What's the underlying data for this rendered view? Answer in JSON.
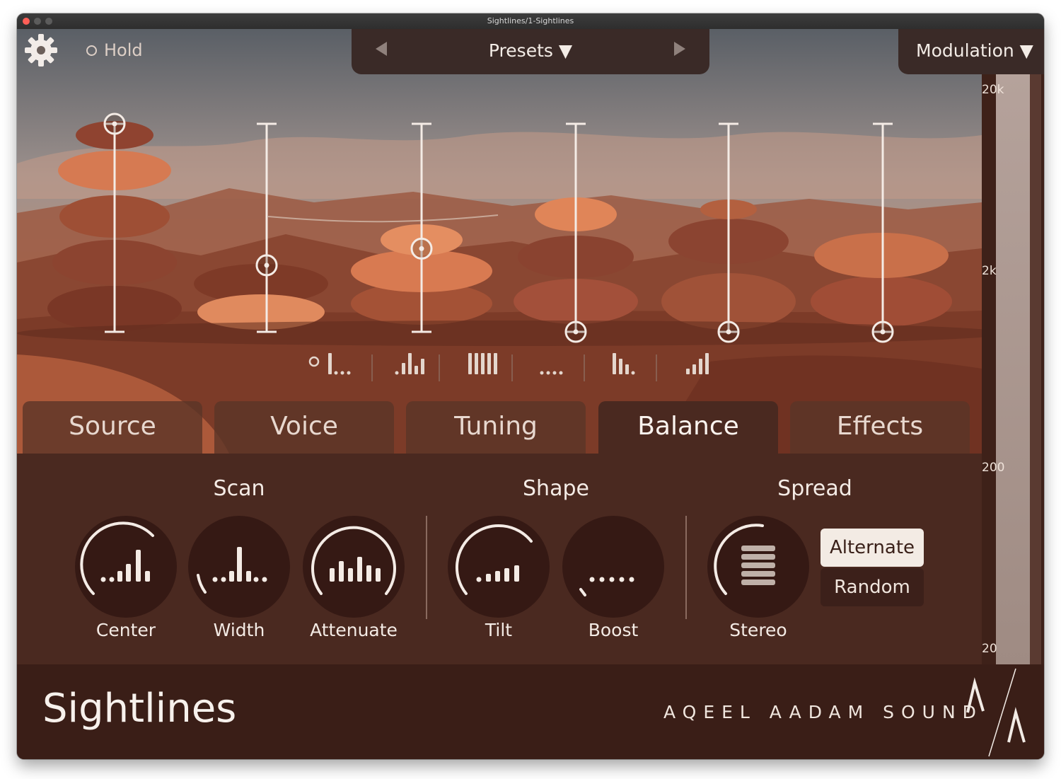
{
  "window": {
    "title": "Sightlines/1-Sightlines"
  },
  "toolbar": {
    "hold_label": "Hold",
    "presets_label": "Presets ▼",
    "modulation_label": "Modulation ▼"
  },
  "meter": {
    "labels": [
      "20k",
      "2k",
      "200",
      "20"
    ]
  },
  "sliders": [
    {
      "value": 1.0,
      "track": "full"
    },
    {
      "value": 0.32,
      "track": "full"
    },
    {
      "value": 0.4,
      "track": "full"
    },
    {
      "value": 0.0,
      "track": "full"
    },
    {
      "value": 0.0,
      "track": "full"
    },
    {
      "value": 0.0,
      "track": "full"
    }
  ],
  "pattern_selector": {
    "selected_index": 0,
    "items": [
      "pattern-first-high-icon",
      "pattern-middle-peak-icon",
      "pattern-even-icon",
      "pattern-flat-icon",
      "pattern-descending-icon",
      "pattern-ascending-icon"
    ]
  },
  "tabs": [
    "Source",
    "Voice",
    "Tuning",
    "Balance",
    "Effects"
  ],
  "active_tab": "Balance",
  "sections": {
    "scan": "Scan",
    "shape": "Shape",
    "spread": "Spread"
  },
  "knobs": {
    "center": "Center",
    "width": "Width",
    "attenuate": "Attenuate",
    "tilt": "Tilt",
    "boost": "Boost",
    "stereo": "Stereo"
  },
  "spread_options": {
    "alternate": "Alternate",
    "random": "Random",
    "selected": "Alternate"
  },
  "footer": {
    "product": "Sightlines",
    "maker": "AQEEL AADAM SOUND"
  },
  "colors": {
    "accent": "#f4ebe5",
    "panel": "#4a2920",
    "footer": "#3a1e17",
    "rock": "#b15c3c"
  }
}
